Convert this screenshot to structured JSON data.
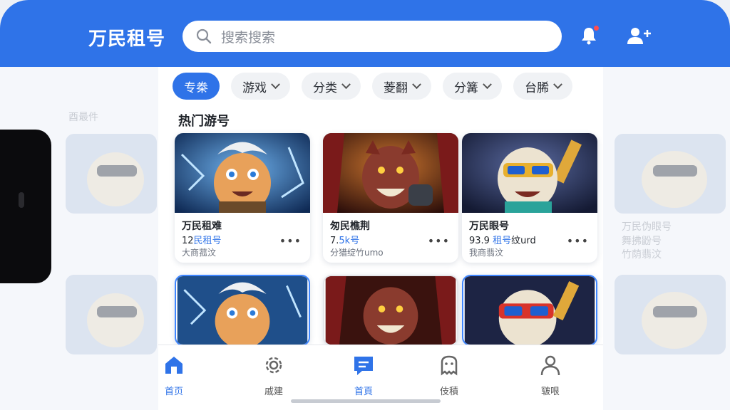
{
  "header": {
    "app_title": "万民租号",
    "search_placeholder": "搜索搜索"
  },
  "filters": [
    {
      "label": "专桊",
      "active": true
    },
    {
      "label": "游戏",
      "active": false
    },
    {
      "label": "分类",
      "active": false
    },
    {
      "label": "菱翻",
      "active": false
    },
    {
      "label": "分篝",
      "active": false
    },
    {
      "label": "台脪",
      "active": false
    }
  ],
  "section_title": "热门游号",
  "cards": [
    {
      "title": "万民租难",
      "meta_prefix": "12",
      "meta_blue": "民租号",
      "meta_suffix": "",
      "sub": "大商菰汶",
      "theme": "blue"
    },
    {
      "title": "匆民樵荆",
      "meta_prefix": "7.",
      "meta_blue": "5k号",
      "meta_suffix": "",
      "sub": "分猎绽竹umo",
      "theme": "red"
    },
    {
      "title": "万民眼号",
      "meta_prefix": "93.9 ",
      "meta_blue": "租号",
      "meta_suffix": "纹urd",
      "sub": "我商翡汶",
      "theme": "navy"
    }
  ],
  "ghost": {
    "left_label": "酉最件",
    "right_title": "万民伪眼号",
    "right_meta": "舞拂鼢号",
    "right_sub": "竹荫翡汶"
  },
  "tabbar": [
    {
      "label": "首页",
      "icon": "home-icon",
      "active": true
    },
    {
      "label": "戚建",
      "icon": "gear-icon",
      "active": false
    },
    {
      "label": "首頁",
      "icon": "message-icon",
      "active": true
    },
    {
      "label": "伎積",
      "icon": "ghost-icon",
      "active": false
    },
    {
      "label": "皲哏",
      "icon": "user-icon",
      "active": false
    }
  ],
  "colors": {
    "primary": "#2f73e8",
    "badge": "#ff4d4f"
  }
}
